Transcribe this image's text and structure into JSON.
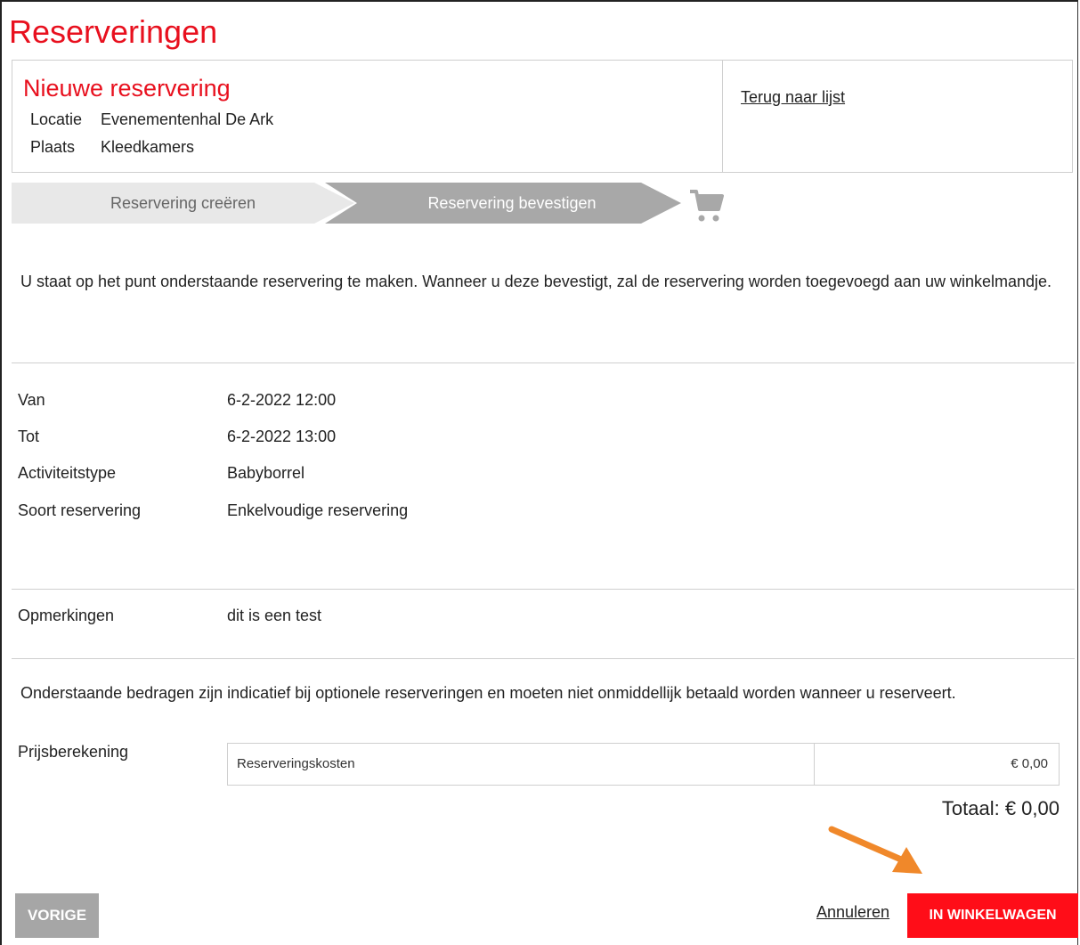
{
  "page": {
    "title": "Reserveringen"
  },
  "header": {
    "subtitle": "Nieuwe reservering",
    "location_label": "Locatie",
    "location_value": "Evenementenhal De Ark",
    "place_label": "Plaats",
    "place_value": "Kleedkamers",
    "back_link": "Terug naar lijst"
  },
  "steps": [
    {
      "label": "Reservering creëren",
      "state": "completed"
    },
    {
      "label": "Reservering bevestigen",
      "state": "active"
    }
  ],
  "icons": {
    "cart": "shopping-cart-icon",
    "arrow": "arrow-annotation-icon"
  },
  "intro": "U staat op het punt onderstaande reservering te maken. Wanneer u deze bevestigt, zal de reservering worden toegevoegd aan uw winkelmandje.",
  "details": [
    {
      "label": "Van",
      "value": "6-2-2022 12:00"
    },
    {
      "label": "Tot",
      "value": "6-2-2022 13:00"
    },
    {
      "label": "Activiteitstype",
      "value": "Babyborrel"
    },
    {
      "label": "Soort reservering",
      "value": "Enkelvoudige reservering"
    }
  ],
  "remarks": {
    "label": "Opmerkingen",
    "value": "dit is een test"
  },
  "disclaimer": "Onderstaande bedragen zijn indicatief bij optionele reserveringen en moeten niet onmiddellijk betaald worden wanneer u reserveert.",
  "pricing": {
    "label": "Prijsberekening",
    "rows": [
      {
        "name": "Reserveringskosten",
        "amount": "€ 0,00"
      }
    ],
    "total": "Totaal: € 0,00"
  },
  "buttons": {
    "previous": "VORIGE",
    "cancel": "Annuleren",
    "add_to_cart": "IN WINKELWAGEN"
  },
  "colors": {
    "brand_red": "#e8101e",
    "button_red": "#ff0d18",
    "step_active": "#a8a8a8",
    "step_done": "#e8e8e8",
    "arrow_orange": "#f0882a"
  }
}
